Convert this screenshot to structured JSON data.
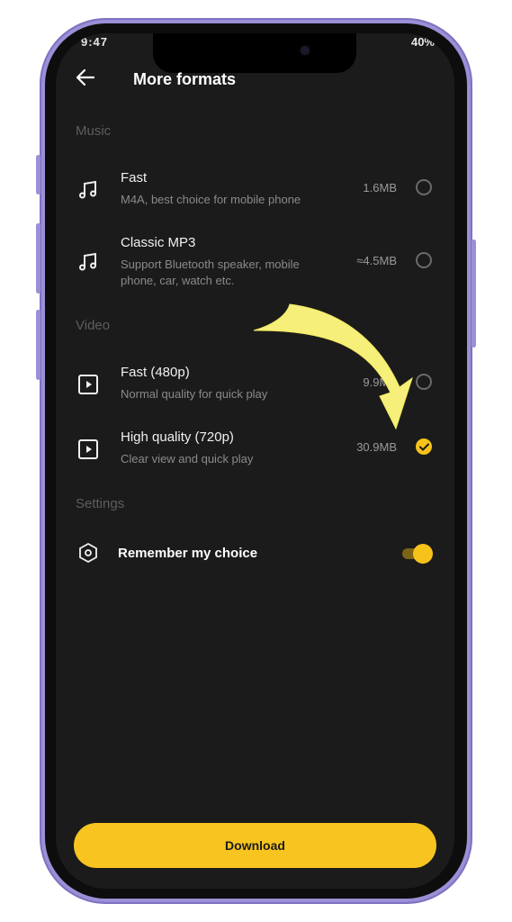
{
  "status_bar": {
    "left": "9:47",
    "right": "40%"
  },
  "header": {
    "title": "More formats"
  },
  "sections": {
    "music": "Music",
    "video": "Video",
    "settings": "Settings"
  },
  "music_items": [
    {
      "title": "Fast",
      "subtitle": "M4A, best choice for mobile phone",
      "size": "1.6MB",
      "icon": "music-note-icon",
      "selected": false
    },
    {
      "title": "Classic MP3",
      "subtitle": "Support Bluetooth speaker, mobile phone, car, watch etc.",
      "size": "≈4.5MB",
      "icon": "music-note-icon",
      "selected": false
    }
  ],
  "video_items": [
    {
      "title": "Fast (480p)",
      "subtitle": "Normal quality for quick play",
      "size": "9.9MB",
      "icon": "play-icon",
      "selected": false
    },
    {
      "title": "High quality (720p)",
      "subtitle": "Clear view and quick play",
      "size": "30.9MB",
      "icon": "play-icon",
      "selected": true
    }
  ],
  "settings": {
    "remember_label": "Remember my choice",
    "remember_on": true
  },
  "download_label": "Download",
  "colors": {
    "accent": "#f7c21a",
    "background": "#1b1b1b",
    "frame": "#9b8fd6",
    "annotation_arrow": "#f6f07a"
  }
}
